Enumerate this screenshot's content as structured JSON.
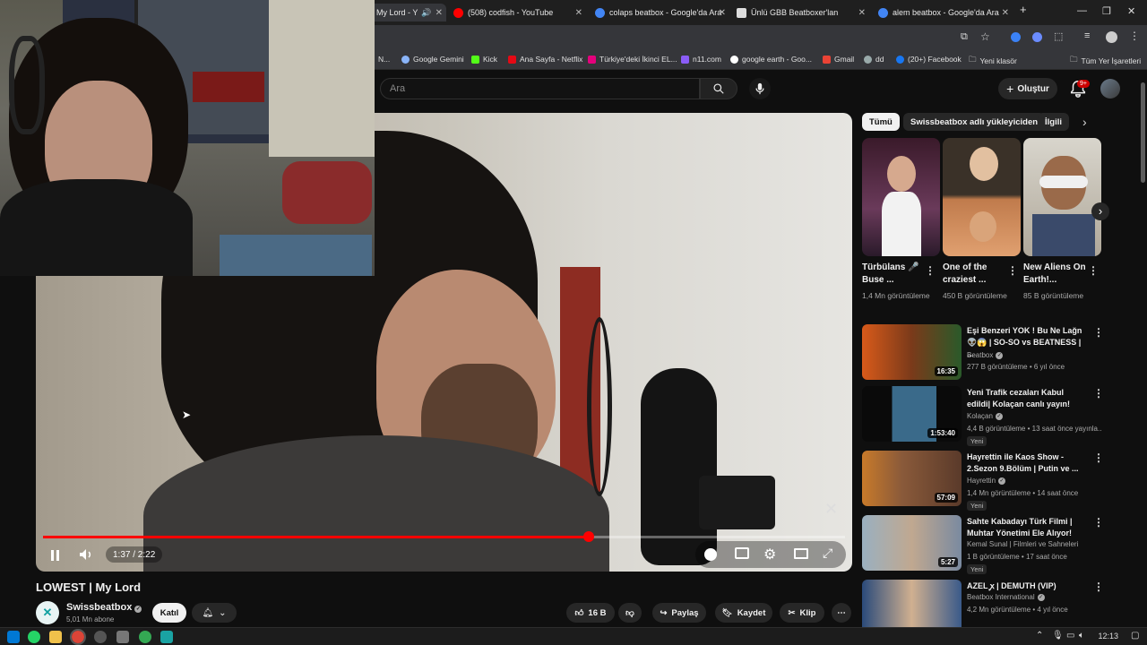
{
  "browser": {
    "tabs": [
      {
        "title": "My Lord - Y",
        "active": true
      },
      {
        "title": "(508) codfish - YouTube"
      },
      {
        "title": "colaps beatbox - Google'da Ara"
      },
      {
        "title": "Ünlü GBB Beatboxer'lan"
      },
      {
        "title": "alem beatbox - Google'da Ara"
      }
    ],
    "bookmarks": [
      "N...",
      "Google Gemini",
      "Kick",
      "Ana Sayfa - Netflix",
      "Türkiye'deki İkinci EL...",
      "n11.com",
      "google earth - Goo...",
      "Gmail",
      "dd",
      "(20+) Facebook",
      "Yeni klasör",
      "Tüm Yer İşaretleri"
    ]
  },
  "header": {
    "search_placeholder": "Ara",
    "create_label": "Oluştur",
    "notifications_badge": "9+"
  },
  "player": {
    "time": "1:37 / 2:22",
    "progress": 0.68,
    "accent": "#ff0000"
  },
  "video": {
    "title": "LOWEST | My Lord",
    "channel": "Swissbeatbox",
    "subscribers": "5,01 Mn abone",
    "join_label": "Katıl",
    "likes": "16 B",
    "share_label": "Paylaş",
    "save_label": "Kaydet",
    "clip_label": "Klip"
  },
  "chips": [
    "Tümü",
    "Swissbeatbox adlı yükleyiciden",
    "İlgili"
  ],
  "shorts": [
    {
      "title": "Türbülans 🎤 Buse ...",
      "views": "1,4 Mn görüntüleme"
    },
    {
      "title": "One of the craziest ...",
      "views": "450 B görüntüleme"
    },
    {
      "title": "New Aliens On Earth!...",
      "views": "85 B görüntüleme"
    }
  ],
  "recommended": [
    {
      "title": "Eşi Benzeri YOK ! Bu Ne Lağn 👽😱 | SO-SO vs BEATNESS | ...",
      "channel": "Beatbox",
      "meta": "277 B görüntüleme • 6 yıl önce",
      "duration": "16:35",
      "new": ""
    },
    {
      "title": "Yeni Trafik cezaları Kabul edildi| Kolaçan canlı yayın!",
      "channel": "Kolaçan",
      "meta": "4,4 B görüntüleme • 13 saat önce yayınla...",
      "duration": "1:53:40",
      "new": "Yeni"
    },
    {
      "title": "Hayrettin ile Kaos Show - 2.Sezon 9.Bölüm | Putin ve ...",
      "channel": "Hayrettin",
      "meta": "1,4 Mn görüntüleme • 14 saat önce",
      "duration": "57:09",
      "new": "Yeni"
    },
    {
      "title": "Sahte Kabadayı Türk Filmi | Muhtar Yönetimi Ele Alıyor!",
      "channel": "Kemal Sunal | Filmleri ve Sahneleri",
      "meta": "1 B görüntüleme • 17 saat önce",
      "duration": "5:27",
      "new": "Yeni"
    },
    {
      "title": "AZEL ꭙ | DEMUTH (VIP)",
      "channel": "Beatbox International",
      "meta": "4,2 Mn görüntüleme • 4 yıl önce",
      "duration": "",
      "new": ""
    }
  ],
  "taskbar": {
    "clock": "12:13"
  }
}
